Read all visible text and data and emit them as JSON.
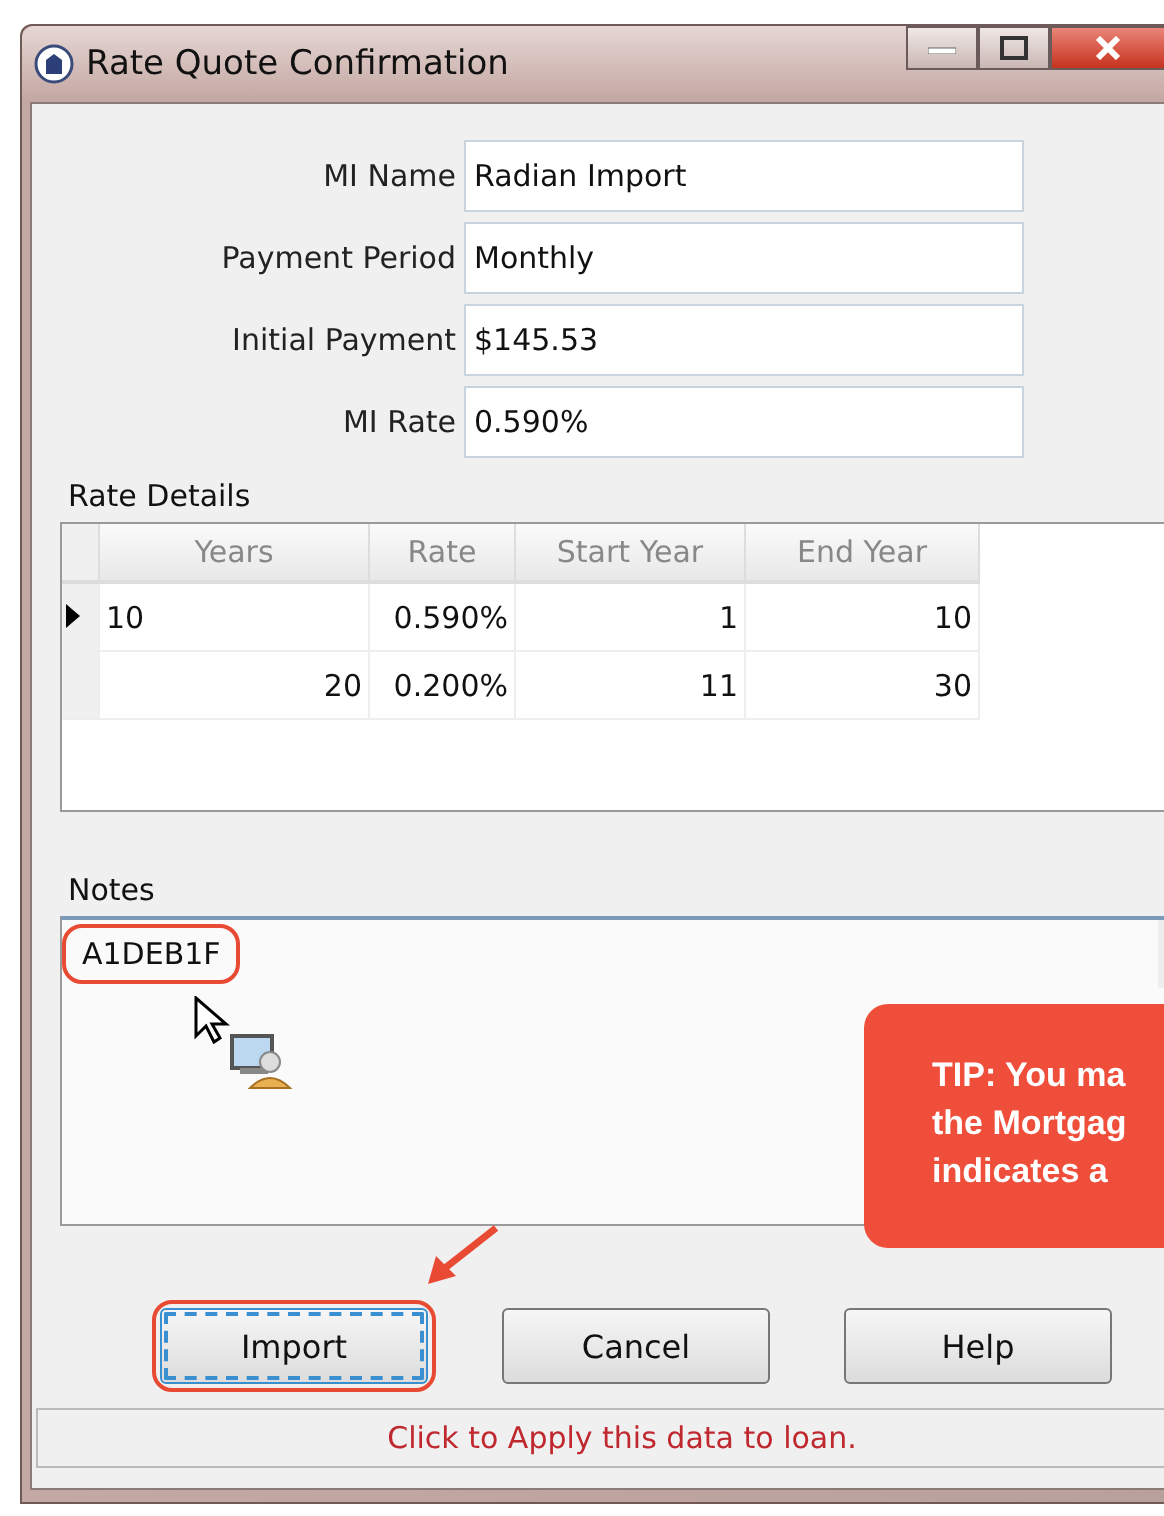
{
  "window": {
    "title": "Rate Quote Confirmation"
  },
  "fields": [
    {
      "label": "MI Name",
      "value": "Radian Import"
    },
    {
      "label": "Payment Period",
      "value": "Monthly"
    },
    {
      "label": "Initial Payment",
      "value": "$145.53"
    },
    {
      "label": "MI Rate",
      "value": "0.590%"
    }
  ],
  "rate_details": {
    "label": "Rate Details",
    "columns": [
      "Years",
      "Rate",
      "Start Year",
      "End Year"
    ],
    "rows": [
      {
        "selected": true,
        "cells": [
          "10",
          "0.590%",
          "1",
          "10"
        ]
      },
      {
        "selected": false,
        "cells": [
          "20",
          "0.200%",
          "11",
          "30"
        ]
      }
    ]
  },
  "notes": {
    "label": "Notes",
    "value": "A1DEB1F",
    "highlighted": true
  },
  "tip": {
    "lines": [
      "TIP: You ma",
      "the Mortgag",
      "indicates a"
    ]
  },
  "buttons": [
    {
      "label": "Import",
      "focused": true,
      "highlighted": true
    },
    {
      "label": "Cancel",
      "focused": false,
      "highlighted": false
    },
    {
      "label": "Help",
      "focused": false,
      "highlighted": false
    }
  ],
  "status_bar": "Click to Apply this data to loan."
}
